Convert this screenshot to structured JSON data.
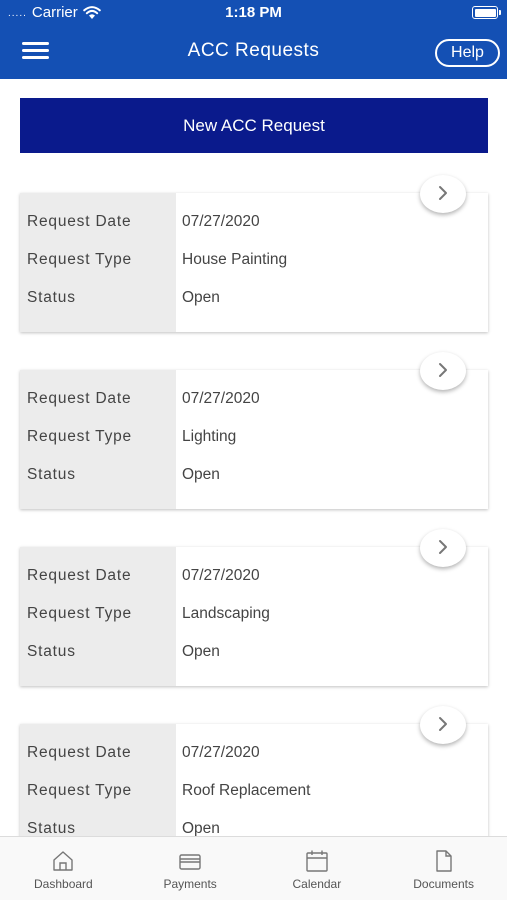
{
  "status_bar": {
    "carrier": "Carrier",
    "time": "1:18 PM",
    "signal_dots": "....."
  },
  "header": {
    "title": "ACC Requests",
    "help_label": "Help"
  },
  "new_request_label": "New ACC Request",
  "labels": {
    "date": "Request Date",
    "type": "Request Type",
    "status": "Status"
  },
  "requests": [
    {
      "date": "07/27/2020",
      "type": "House Painting",
      "status": "Open"
    },
    {
      "date": "07/27/2020",
      "type": "Lighting",
      "status": "Open"
    },
    {
      "date": "07/27/2020",
      "type": "Landscaping",
      "status": "Open"
    },
    {
      "date": "07/27/2020",
      "type": "Roof Replacement",
      "status": "Open"
    }
  ],
  "tabs": [
    {
      "label": "Dashboard",
      "icon": "home-icon"
    },
    {
      "label": "Payments",
      "icon": "credit-card-icon"
    },
    {
      "label": "Calendar",
      "icon": "calendar-icon"
    },
    {
      "label": "Documents",
      "icon": "document-icon"
    }
  ],
  "colors": {
    "header": "#1450b4",
    "new_button": "#0a1a8c",
    "label_column": "#ececec"
  }
}
